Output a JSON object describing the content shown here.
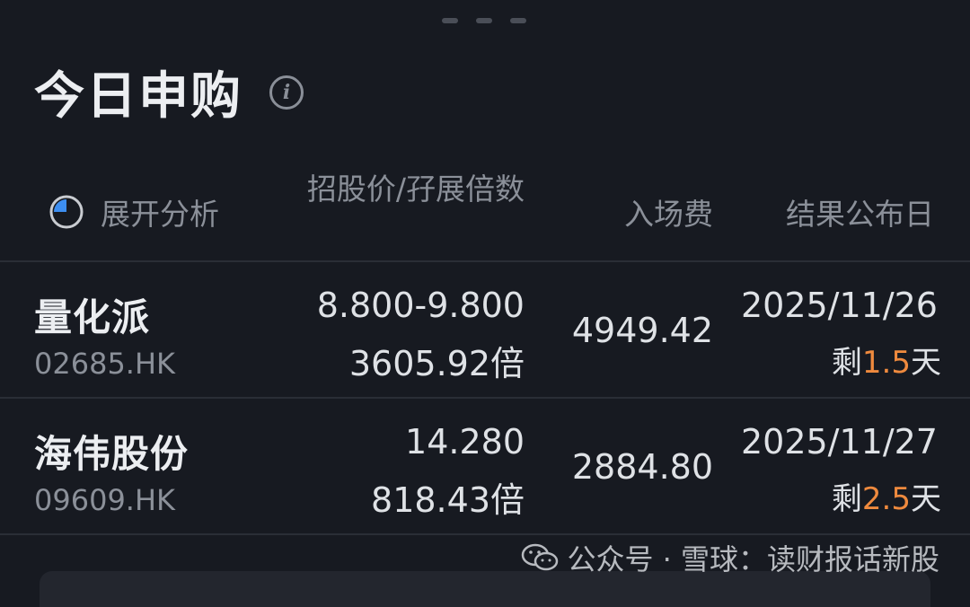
{
  "header": {
    "title": "今日申购",
    "info_icon": "info-icon"
  },
  "columns": {
    "expand_label": "展开分析",
    "price_oversub": "招股价/孖展倍数",
    "entry_fee": "入场费",
    "result_date": "结果公布日"
  },
  "rows": [
    {
      "name": "量化派",
      "code": "02685.HK",
      "price_range": "8.800-9.800",
      "oversub": "3605.92倍",
      "entry_fee": "4949.42",
      "result_date": "2025/11/26",
      "remain_prefix": "剩",
      "remain_days": "1.5",
      "remain_suffix": "天"
    },
    {
      "name": "海伟股份",
      "code": "09609.HK",
      "price_range": "14.280",
      "oversub": "818.43倍",
      "entry_fee": "2884.80",
      "result_date": "2025/11/27",
      "remain_prefix": "剩",
      "remain_days": "2.5",
      "remain_suffix": "天"
    }
  ],
  "watermark": {
    "text": "公众号 · 雪球：读财报话新股"
  },
  "colors": {
    "background": "#171a21",
    "accent_blue": "#3d8ef0",
    "days_orange": "#ef8a3e"
  }
}
